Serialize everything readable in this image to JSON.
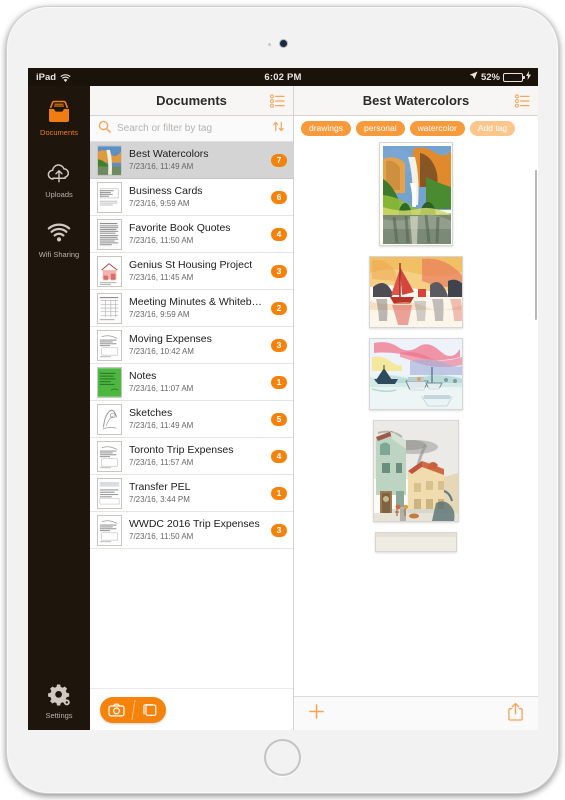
{
  "status_bar": {
    "device_label": "iPad",
    "wifi_icon": "wifi-icon",
    "time": "6:02 PM",
    "location_icon": "location-arrow-icon",
    "battery_percent": "52%",
    "battery_level": 52,
    "battery_charging": true
  },
  "sidebar": {
    "items": [
      {
        "label": "Documents",
        "icon": "documents-tray-icon",
        "active": true
      },
      {
        "label": "Uploads",
        "icon": "cloud-upload-icon",
        "active": false
      },
      {
        "label": "Wifi Sharing",
        "icon": "wifi-sharing-icon",
        "active": false
      },
      {
        "label": "Settings",
        "icon": "gear-icon",
        "active": false
      }
    ]
  },
  "documents_panel": {
    "title": "Documents",
    "list_icon": "checklist-icon",
    "search": {
      "placeholder": "Search or filter by tag",
      "value": "",
      "search_icon": "search-icon",
      "sort_icon": "sort-az-icon"
    },
    "items": [
      {
        "name": "Best Watercolors",
        "date": "7/23/16, 11:49 AM",
        "badge": "7",
        "selected": true,
        "thumb": "thumb-watercolor"
      },
      {
        "name": "Business Cards",
        "date": "7/23/16, 9:59 AM",
        "badge": "6",
        "selected": false,
        "thumb": "thumb-card"
      },
      {
        "name": "Favorite Book Quotes",
        "date": "7/23/16, 11:50 AM",
        "badge": "4",
        "selected": false,
        "thumb": "thumb-text"
      },
      {
        "name": "Genius St Housing Project",
        "date": "7/23/16, 11:45 AM",
        "badge": "3",
        "selected": false,
        "thumb": "thumb-plan"
      },
      {
        "name": "Meeting Minutes & Whiteb…",
        "date": "7/23/16, 9:59 AM",
        "badge": "2",
        "selected": false,
        "thumb": "thumb-grid"
      },
      {
        "name": "Moving Expenses",
        "date": "7/23/16, 10:42 AM",
        "badge": "3",
        "selected": false,
        "thumb": "thumb-receipt"
      },
      {
        "name": "Notes",
        "date": "7/23/16, 11:07 AM",
        "badge": "1",
        "selected": false,
        "thumb": "thumb-green-note"
      },
      {
        "name": "Sketches",
        "date": "7/23/16, 11:49 AM",
        "badge": "5",
        "selected": false,
        "thumb": "thumb-sketch"
      },
      {
        "name": "Toronto Trip Expenses",
        "date": "7/23/16, 11:57 AM",
        "badge": "4",
        "selected": false,
        "thumb": "thumb-receipt"
      },
      {
        "name": "Transfer PEL",
        "date": "7/23/16, 3:44 PM",
        "badge": "1",
        "selected": false,
        "thumb": "thumb-form"
      },
      {
        "name": "WWDC 2016 Trip Expenses",
        "date": "7/23/16, 11:50 AM",
        "badge": "3",
        "selected": false,
        "thumb": "thumb-receipt"
      }
    ],
    "footer": {
      "camera_icon": "camera-icon",
      "pages_icon": "document-pages-icon"
    }
  },
  "detail_panel": {
    "title": "Best Watercolors",
    "list_icon": "checklist-icon",
    "tags": [
      {
        "label": "drawings",
        "add": false
      },
      {
        "label": "personal",
        "add": false
      },
      {
        "label": "watercolor",
        "add": false
      },
      {
        "label": "Add tag",
        "add": true
      }
    ],
    "pages": [
      {
        "name": "waterfall-canyon-painting"
      },
      {
        "name": "red-junk-boat-sunset-painting"
      },
      {
        "name": "harbor-boats-pink-sky-painting"
      },
      {
        "name": "village-street-scene-painting"
      },
      {
        "name": "partial-page-preview"
      }
    ],
    "footer": {
      "add_icon": "plus-icon",
      "share_icon": "share-export-icon"
    }
  },
  "theme": {
    "accent": "#f5820b",
    "tag": "#f79a3c",
    "tag_muted": "#fbc68c",
    "sidebar_bg": "#1e160d",
    "selected_row": "#d4d4d4",
    "battery_green": "#4cd964"
  }
}
